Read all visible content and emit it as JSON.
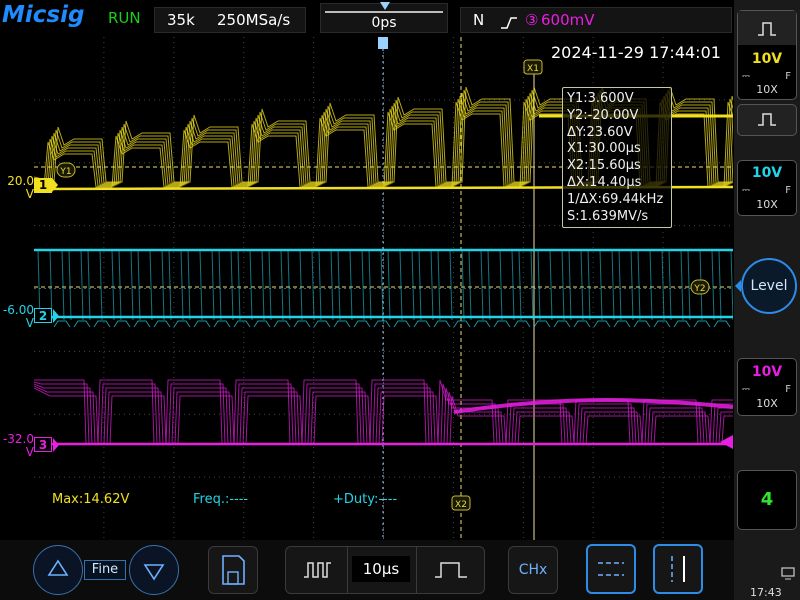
{
  "brand": {
    "logo": "Micsig",
    "run_state": "RUN"
  },
  "acquisition": {
    "memory_depth": "35k",
    "sample_rate": "250MSa/s",
    "horizontal_position": "0ps"
  },
  "trigger": {
    "mode": "N",
    "source": "③",
    "level": "600mV"
  },
  "timestamp": "2024-11-29 17:44:01",
  "channels": [
    {
      "name": "1",
      "offset": "20.0",
      "unit": "V",
      "volts_div": "10V",
      "coupling": "F",
      "probe": "10X",
      "color": "#f0e020"
    },
    {
      "name": "2",
      "offset": "-6.00",
      "unit": "V",
      "volts_div": "10V",
      "coupling": "F",
      "probe": "10X",
      "color": "#22d4e8"
    },
    {
      "name": "3",
      "offset": "-32.0",
      "unit": "V",
      "volts_div": "10V",
      "coupling": "F",
      "probe": "10X",
      "color": "#e81ee0"
    }
  ],
  "cursors": {
    "x1_label": "X1",
    "x2_label": "X2",
    "y1_label": "Y1",
    "y2_label": "Y2",
    "readout": [
      "Y1:3.600V",
      "Y2:-20.00V",
      "ΔY:23.60V",
      "X1:30.00μs",
      "X2:15.60μs",
      "ΔX:14.40μs",
      "1/ΔX:69.44kHz",
      "S:1.639MV/s"
    ]
  },
  "measurements": {
    "max": "Max:14.62V",
    "freq": "Freq.:----",
    "duty": "+Duty:----"
  },
  "right_panel": {
    "level_label": "Level",
    "ch4_label": "4"
  },
  "bottom": {
    "fine_label": "Fine",
    "time_div": "10μs",
    "chx_label": "CHx"
  },
  "status": {
    "clock": "17:43"
  },
  "colors": {
    "ch1": "#f0e020",
    "ch2": "#22d4e8",
    "ch3": "#e81ee0",
    "accent": "#2d8ce6"
  }
}
